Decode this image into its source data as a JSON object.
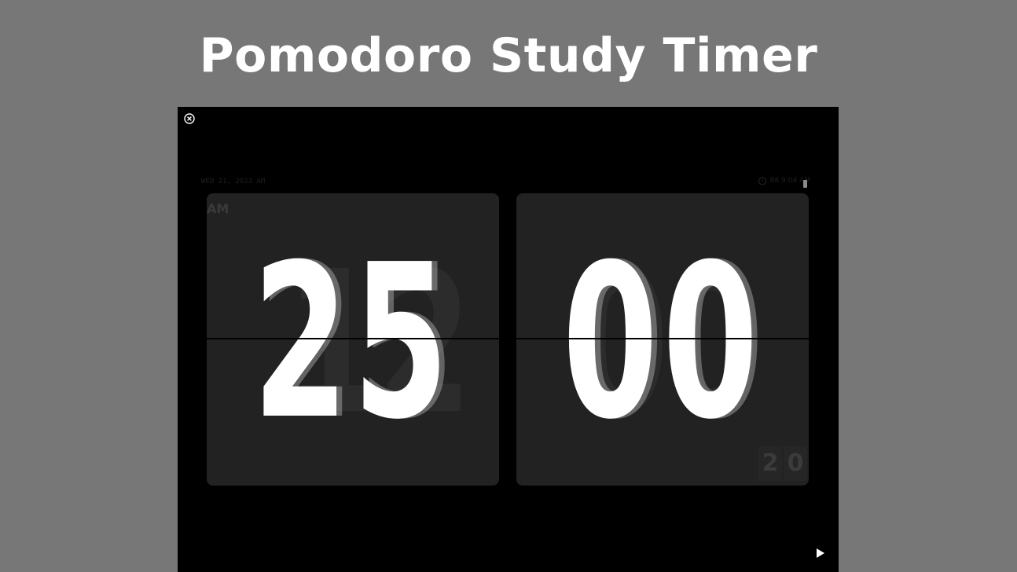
{
  "page": {
    "title": "Pomodoro Study Timer"
  },
  "timer": {
    "minutes": "25",
    "seconds": "00",
    "ampm": "AM",
    "background_clock_hours": "12",
    "background_clock_minutes": "00",
    "mini_digits": [
      "2",
      "0"
    ]
  },
  "status_bar": {
    "date": "WED 21, 2023 AM",
    "right_text": "88 9:04 AM"
  },
  "icons": {
    "close": "close-circle-icon",
    "play": "play-icon",
    "alarm": "alarm-clock-icon",
    "battery": "battery-icon"
  },
  "colors": {
    "page_bg": "#777777",
    "stage_bg": "#000000",
    "card_bg": "#222222",
    "digit": "#ffffff"
  }
}
